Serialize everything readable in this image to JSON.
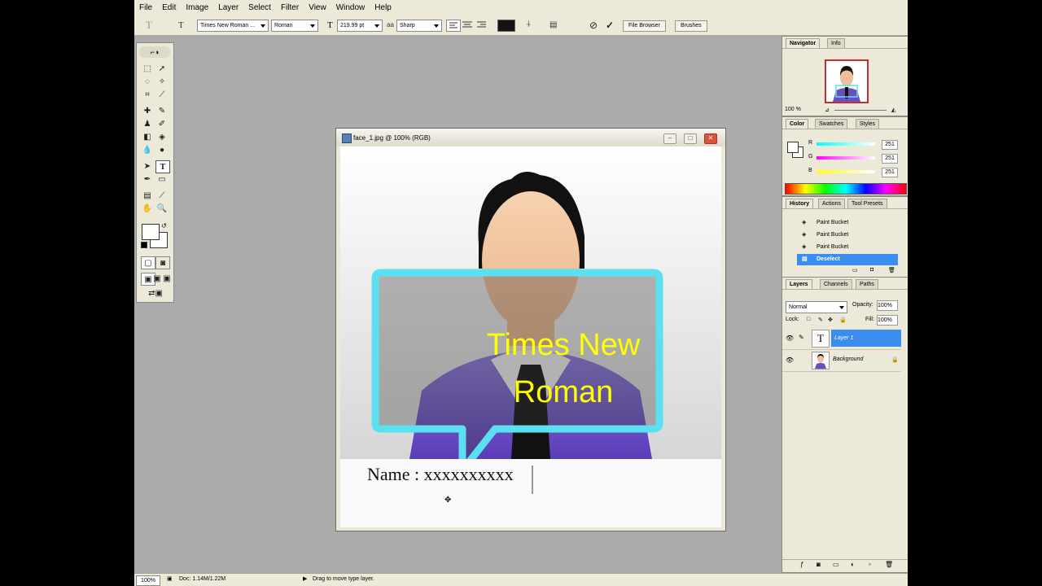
{
  "menu": [
    "File",
    "Edit",
    "Image",
    "Layer",
    "Select",
    "Filter",
    "View",
    "Window",
    "Help"
  ],
  "options": {
    "tool_icon": "T",
    "font_family": "Times New Roman ...",
    "font_style": "Roman",
    "font_size": "219.99 pt",
    "antialias_icon": "aa",
    "antialias": "Sharp",
    "color_hex": "#141414",
    "cancel_icon": "⊘",
    "commit_icon": "✓",
    "file_browser": "File Browser",
    "brushes": "Brushes"
  },
  "document": {
    "title": "face_1.jpg @ 100% (RGB)",
    "headline_line1": "Times New",
    "headline_line2": "Roman",
    "name_text": "Name : xxxxxxxxxx"
  },
  "navigator": {
    "tabs": [
      "Navigator",
      "Info"
    ],
    "zoom": "100 %"
  },
  "color_panel": {
    "tabs": [
      "Color",
      "Swatches",
      "Styles"
    ],
    "channels": [
      {
        "label": "R",
        "value": "251"
      },
      {
        "label": "G",
        "value": "251"
      },
      {
        "label": "B",
        "value": "251"
      }
    ]
  },
  "history": {
    "tabs": [
      "History",
      "Actions",
      "Tool Presets"
    ],
    "items": [
      "Paint Bucket",
      "Paint Bucket",
      "Paint Bucket",
      "Deselect"
    ]
  },
  "layers": {
    "tabs": [
      "Layers",
      "Channels",
      "Paths"
    ],
    "blend_mode": "Normal",
    "opacity_label": "Opacity:",
    "opacity": "100%",
    "lock_label": "Lock:",
    "fill_label": "Fill:",
    "fill": "100%",
    "items": [
      {
        "name": "Layer 1",
        "type": "text"
      },
      {
        "name": "Background",
        "type": "image"
      }
    ]
  },
  "status": {
    "zoom": "100%",
    "doc": "Doc: 1.14M/1.22M",
    "hint": "Drag to move type layer."
  },
  "colors": {
    "highlight": "#3b8df2",
    "bubble": "#5ae0f0",
    "headline": "#ffff00",
    "suit": "#6a4fc4"
  }
}
